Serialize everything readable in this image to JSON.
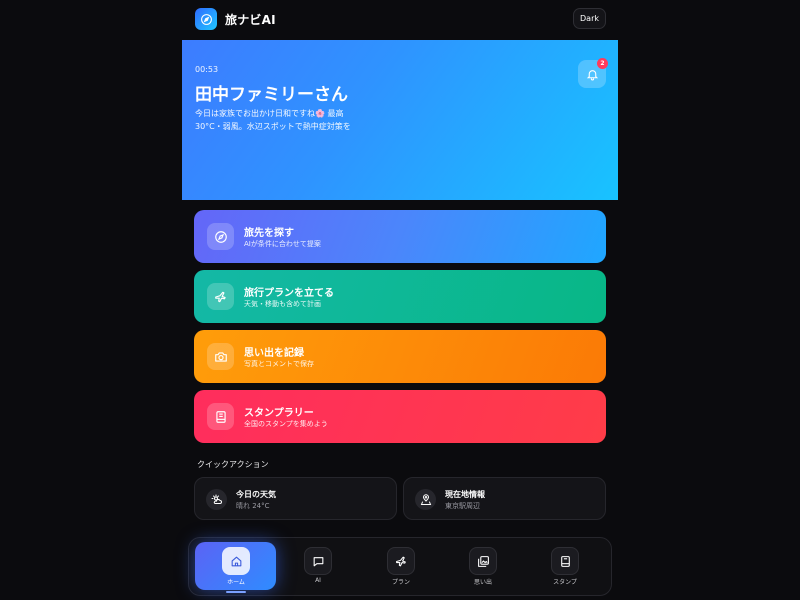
{
  "header": {
    "app_title": "旅ナビAI",
    "theme_button": "Dark",
    "logo_icon": "compass-icon"
  },
  "hero": {
    "time": "00:53",
    "greeting": "田中ファミリーさん",
    "message_line1": "今日は家族でお出かけ日和ですね🌸 最高",
    "message_line2": "30°C・弱風。水辺スポットで熱中症対策を",
    "notification_count": "2",
    "bell_icon": "bell-icon"
  },
  "cards": [
    {
      "title": "旅先を探す",
      "subtitle": "AIが条件に合わせて提案",
      "icon": "compass-icon",
      "color": "#4b86fb"
    },
    {
      "title": "旅行プランを立てる",
      "subtitle": "天気・移動も含めて計画",
      "icon": "plane-icon",
      "color": "#10b897"
    },
    {
      "title": "思い出を記録",
      "subtitle": "写真とコメントで保存",
      "icon": "camera-icon",
      "color": "#fd8b08"
    },
    {
      "title": "スタンプラリー",
      "subtitle": "全国のスタンプを集めよう",
      "icon": "book-icon",
      "color": "#ff3452"
    }
  ],
  "quick_actions": {
    "title": "クイックアクション",
    "items": [
      {
        "label": "今日の天気",
        "sub": "晴れ 24°C",
        "icon": "weather-icon"
      },
      {
        "label": "現在地情報",
        "sub": "東京駅周辺",
        "icon": "location-icon"
      }
    ]
  },
  "bottom_nav": {
    "items": [
      {
        "label": "ホーム",
        "icon": "home-icon",
        "active": true
      },
      {
        "label": "AI",
        "icon": "chat-icon",
        "active": false
      },
      {
        "label": "プラン",
        "icon": "plane-icon",
        "active": false
      },
      {
        "label": "思い出",
        "icon": "gallery-icon",
        "active": false
      },
      {
        "label": "スタンプ",
        "icon": "book-icon",
        "active": false
      }
    ]
  }
}
